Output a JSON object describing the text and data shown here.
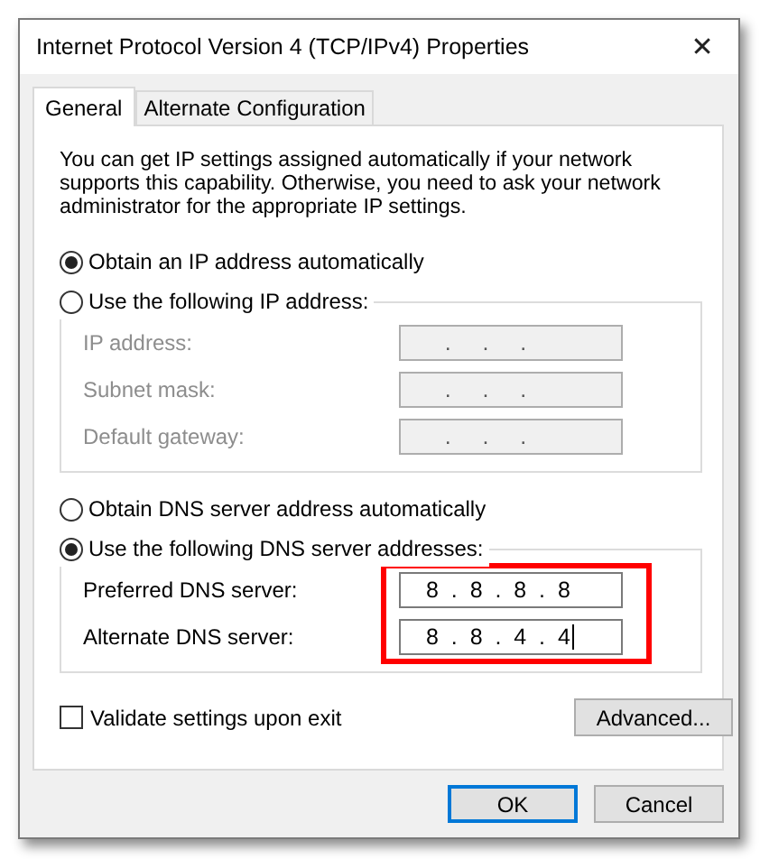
{
  "window": {
    "title": "Internet Protocol Version 4 (TCP/IPv4) Properties",
    "close": "✕"
  },
  "tabs": [
    {
      "label": "General",
      "selected": true
    },
    {
      "label": "Alternate Configuration",
      "selected": false
    }
  ],
  "intro": "You can get IP settings assigned automatically if your network supports this capability. Otherwise, you need to ask your network administrator for the appropriate IP settings.",
  "ip_mode": [
    {
      "label": "Obtain an IP address automatically",
      "selected": true
    },
    {
      "label": "Use the following IP address:",
      "selected": false
    }
  ],
  "ip_fields": [
    {
      "label": "IP address:",
      "value": "   .     .     .",
      "disabled": true
    },
    {
      "label": "Subnet mask:",
      "value": "   .     .     .",
      "disabled": true
    },
    {
      "label": "Default gateway:",
      "value": "   .     .     .",
      "disabled": true
    }
  ],
  "dns_mode": [
    {
      "label": "Obtain DNS server address automatically",
      "selected": false
    },
    {
      "label": "Use the following DNS server addresses:",
      "selected": true
    }
  ],
  "dns_fields": [
    {
      "label": "Preferred DNS server:",
      "value": "8  .  8  .  8  .  8",
      "disabled": false
    },
    {
      "label": "Alternate DNS server:",
      "value": "8  .  8  .  4  .  4",
      "disabled": false,
      "caret": true
    }
  ],
  "highlight": {
    "kind": "box"
  },
  "validate": {
    "label": "Validate settings upon exit",
    "checked": false
  },
  "advanced_button": "Advanced...",
  "buttons": [
    {
      "label": "OK",
      "default": true
    },
    {
      "label": "Cancel",
      "default": false
    }
  ]
}
